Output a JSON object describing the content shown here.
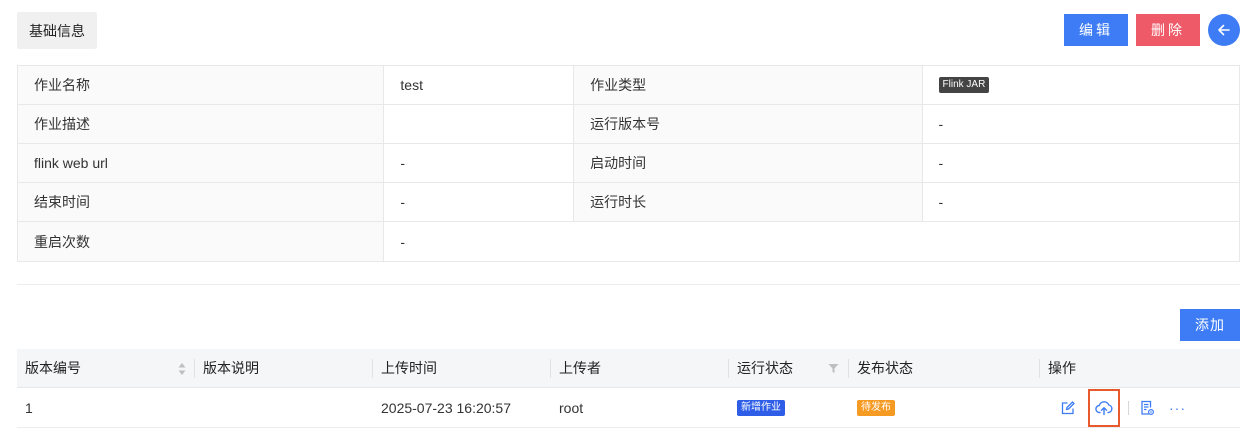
{
  "tab": {
    "label": "基础信息"
  },
  "toolbar": {
    "edit_label": "编辑",
    "delete_label": "删除",
    "add_label": "添加"
  },
  "info": {
    "rows": [
      {
        "label1": "作业名称",
        "value1": "test",
        "label2": "作业类型",
        "value2": "Flink JAR"
      },
      {
        "label1": "作业描述",
        "value1": "",
        "label2": "运行版本号",
        "value2": "-"
      },
      {
        "label1": "flink web url",
        "value1": "-",
        "label2": "启动时间",
        "value2": "-"
      },
      {
        "label1": "结束时间",
        "value1": "-",
        "label2": "运行时长",
        "value2": "-"
      },
      {
        "label1": "重启次数",
        "value1": "-"
      }
    ]
  },
  "versions": {
    "columns": [
      "版本编号",
      "版本说明",
      "上传时间",
      "上传者",
      "运行状态",
      "发布状态",
      "操作"
    ],
    "rows": [
      {
        "id": "1",
        "desc": "",
        "upload_time": "2025-07-23 16:20:57",
        "uploader": "root",
        "run_status": "新增作业",
        "publish_status": "待发布"
      }
    ],
    "more_label": "···"
  },
  "colors": {
    "primary": "#3d7cf5",
    "danger": "#ee5a68",
    "tag_blue": "#2e5ee8",
    "tag_orange": "#f59a23",
    "highlight": "#e85a2e"
  }
}
